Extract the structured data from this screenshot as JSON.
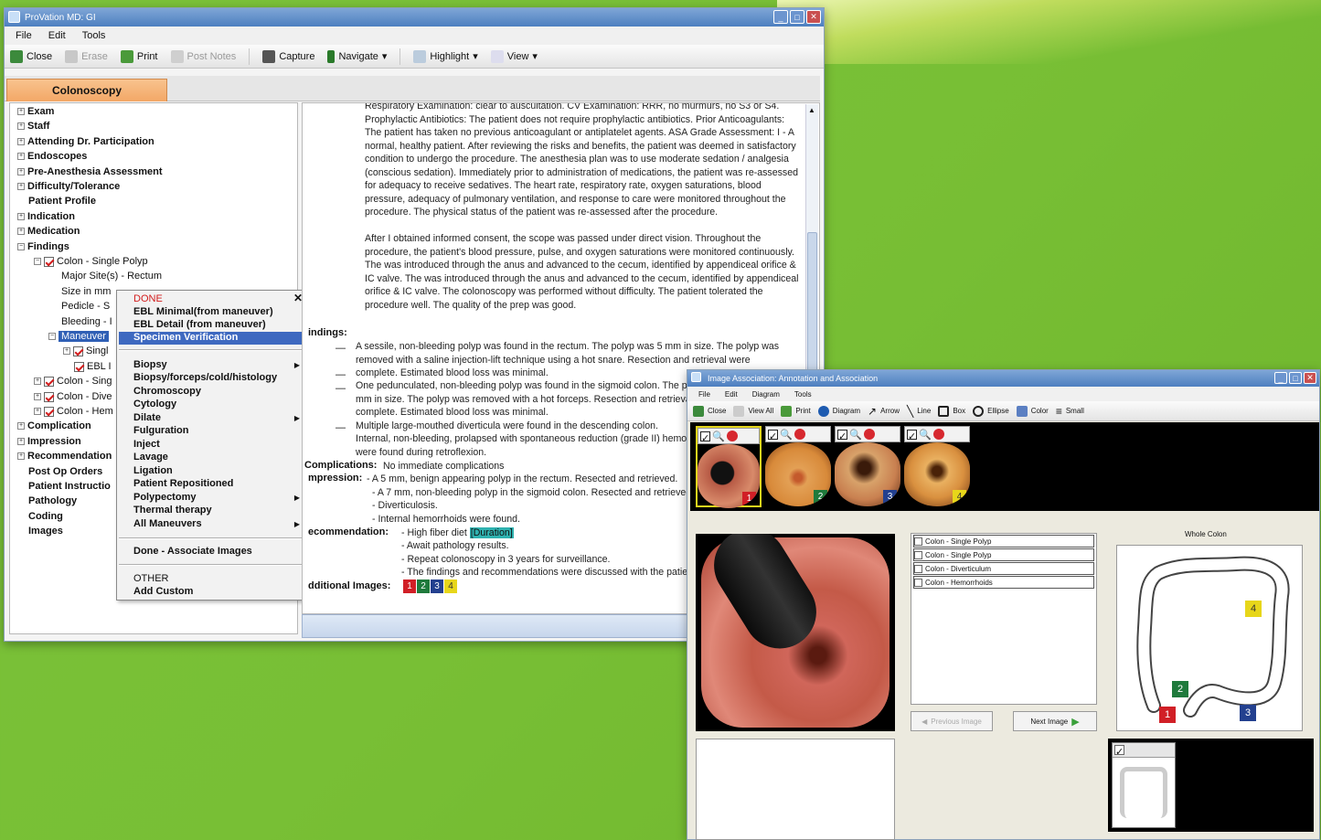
{
  "main_window": {
    "title": "ProVation MD: GI",
    "menu": [
      "File",
      "Edit",
      "Tools"
    ],
    "toolbar": {
      "close": "Close",
      "erase": "Erase",
      "print": "Print",
      "post_notes": "Post Notes",
      "capture": "Capture",
      "navigate": "Navigate",
      "highlight": "Highlight",
      "view": "View"
    },
    "tab": "Colonoscopy",
    "tree": {
      "exam": "Exam",
      "staff": "Staff",
      "attending": "Attending Dr. Participation",
      "endoscopes": "Endoscopes",
      "preanesthesia": "Pre-Anesthesia Assessment",
      "difficulty": "Difficulty/Tolerance",
      "patient_profile": "Patient Profile",
      "indication": "Indication",
      "medication": "Medication",
      "findings": "Findings",
      "single_polyp": "Colon - Single Polyp",
      "major_sites": "Major Site(s) - Rectum",
      "size": "Size in mm",
      "pedicle": "Pedicle - S",
      "bleeding": "Bleeding - I",
      "maneuver": "Maneuver",
      "single": "Singl",
      "ebl": "EBL I",
      "colon_sing": "Colon - Sing",
      "colon_dive": "Colon - Dive",
      "colon_hem": "Colon - Hem",
      "complication": "Complication",
      "impression": "Impression",
      "recommendation": "Recommendation",
      "postop": "Post Op Orders",
      "patient_instr": "Patient Instructio",
      "pathology": "Pathology",
      "coding": "Coding",
      "images": "Images"
    },
    "context_menu": {
      "done": "DONE",
      "ebl_min": "EBL Minimal(from maneuver)",
      "ebl_detail": "EBL Detail (from maneuver)",
      "specimen": "Specimen Verification",
      "biopsy": "Biopsy",
      "biopsy_forceps": "Biopsy/forceps/cold/histology",
      "chromoscopy": "Chromoscopy",
      "cytology": "Cytology",
      "dilate": "Dilate",
      "fulguration": "Fulguration",
      "inject": "Inject",
      "lavage": "Lavage",
      "ligation": "Ligation",
      "repositioned": "Patient Repositioned",
      "polypectomy": "Polypectomy",
      "thermal": "Thermal therapy",
      "all_maneuvers": "All Maneuvers",
      "done_assoc": "Done - Associate Images",
      "other": "OTHER",
      "add_custom": "Add Custom"
    },
    "report": {
      "paragraph1": "Respiratory Examination: clear to auscultation. CV Examination: RRR, no murmurs, no S3 or S4. Prophylactic Antibiotics: The patient does not require prophylactic antibiotics. Prior Anticoagulants: The patient has taken no previous anticoagulant or antiplatelet agents. ASA Grade Assessment: I - A normal, healthy patient. After reviewing the risks and benefits, the patient was deemed in satisfactory condition to undergo the procedure. The anesthesia plan was to use moderate sedation / analgesia (conscious sedation). Immediately prior to administration of medications, the patient was re-assessed for adequacy to receive sedatives. The heart rate, respiratory rate, oxygen saturations, blood pressure, adequacy of pulmonary ventilation, and response to care were monitored throughout the procedure. The physical status of the patient was re-assessed after the procedure.",
      "paragraph2": "After I obtained informed consent, the scope was passed under direct vision. Throughout the procedure, the patient's blood pressure, pulse, and oxygen saturations were monitored continuously. The was introduced through the anus and advanced to the cecum, identified by appendiceal orifice & IC valve. The was introduced through the anus and advanced to the cecum, identified by appendiceal orifice & IC valve. The colonoscopy was performed without difficulty. The patient tolerated the procedure well. The quality of the prep was good.",
      "findings_label": "indings:",
      "finding1": "A sessile, non-bleeding polyp was found in the rectum. The polyp was 5 mm in size. The polyp was removed with a saline injection-lift technique using a hot snare. Resection and retrieval were complete. Estimated blood loss was minimal.",
      "finding2": "One pedunculated, non-bleeding polyp was found in the sigmoid colon. The polyp was 7 mm in size. The polyp was removed with a hot forceps. Resection and retrieval were complete. Estimated blood loss was minimal.",
      "finding3": "Multiple large-mouthed diverticula were found in the descending colon.",
      "finding4": "Internal, non-bleeding, prolapsed with spontaneous reduction (grade II) hemorrhoids were found during retroflexion.",
      "complications_label": "Complications:",
      "complications": "No immediate complications",
      "impression_label": "mpression:",
      "impression1": "- A 5 mm, benign appearing polyp in the rectum. Resected and retrieved.",
      "impression2": "- A 7 mm, non-bleeding polyp in the sigmoid colon. Resected and retrieved.",
      "impression3": "- Diverticulosis.",
      "impression4": "- Internal hemorrhoids were found.",
      "recommendation_label": "ecommendation:",
      "rec1": "- High fiber diet",
      "rec1_tag": "[Duration]",
      "rec2": "- Await pathology results.",
      "rec3": "- Repeat colonoscopy in 3 years for surveillance.",
      "rec4": "- The findings and recommendations were discussed with the patient.",
      "additional_label": "dditional Images:",
      "markers": [
        "1",
        "2",
        "3",
        "4"
      ]
    }
  },
  "image_window": {
    "title": "Image Association: Annotation and Association",
    "menu": [
      "File",
      "Edit",
      "Diagram",
      "Tools"
    ],
    "toolbar": [
      "Close",
      "View All",
      "Print",
      "Diagram",
      "Arrow",
      "Line",
      "Box",
      "Ellipse",
      "Color",
      "Small"
    ],
    "thumbnails": [
      "1",
      "2",
      "3",
      "4"
    ],
    "findings_list": [
      "Colon - Single Polyp",
      "Colon - Single Polyp",
      "Colon - Diverticulum",
      "Colon - Hemorrhoids"
    ],
    "diagram_title": "Whole Colon",
    "diagram_markers": [
      "1",
      "2",
      "3",
      "4"
    ],
    "prev_button": "Previous Image",
    "next_button": "Next Image"
  },
  "colors": {
    "marker1": "#d11f26",
    "marker2": "#1f7a3c",
    "marker3": "#23408f",
    "marker4": "#e7d61a"
  }
}
